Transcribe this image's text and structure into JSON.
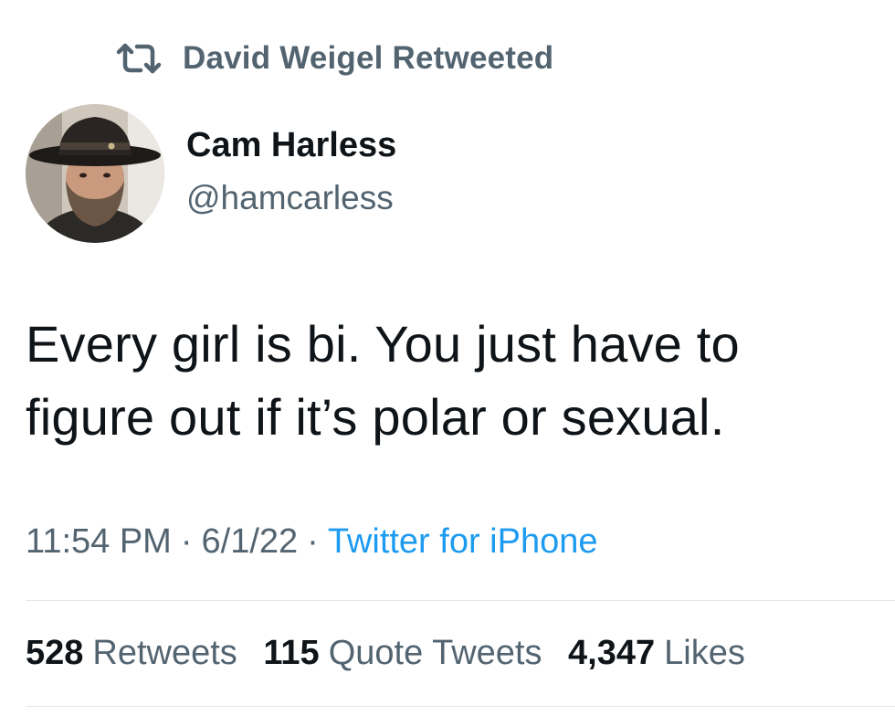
{
  "retweet": {
    "icon": "retweet-icon",
    "label": "David Weigel Retweeted"
  },
  "author": {
    "avatar": "avatar",
    "name": "Cam Harless",
    "handle": "@hamcarless"
  },
  "tweet": {
    "text_line1": "Every girl is bi. You just have to",
    "text_line2": "figure out if it’s polar or sexual."
  },
  "meta": {
    "time": "11:54 PM",
    "separator": "·",
    "date": "6/1/22",
    "source": "Twitter for iPhone"
  },
  "stats": {
    "retweets": {
      "count": "528",
      "label": "Retweets"
    },
    "quote_tweets": {
      "count": "115",
      "label": "Quote Tweets"
    },
    "likes": {
      "count": "4,347",
      "label": "Likes"
    }
  },
  "colors": {
    "text_primary": "#0f1419",
    "text_secondary": "#536471",
    "link": "#1d9bf0",
    "divider": "#e3e6e9"
  }
}
